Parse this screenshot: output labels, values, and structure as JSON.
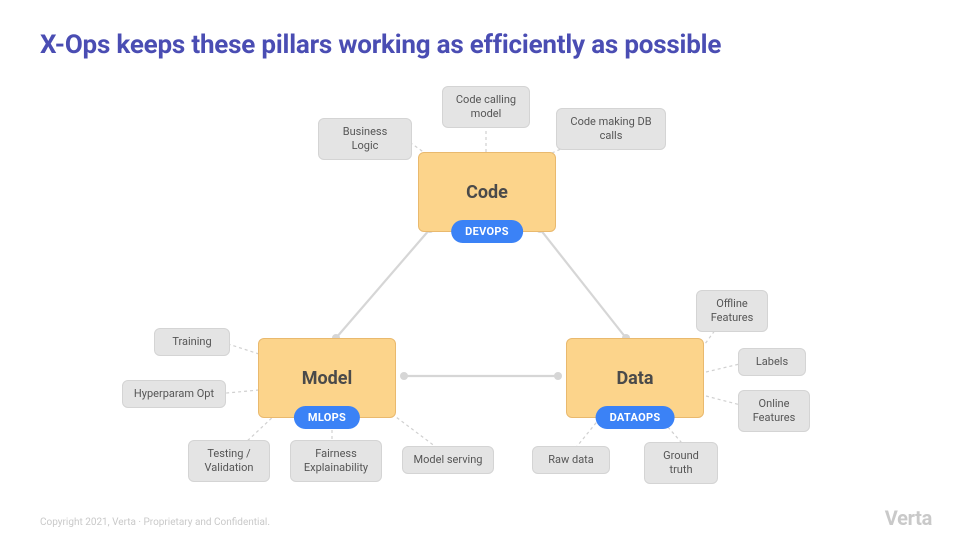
{
  "title": "X-Ops keeps these pillars working as efficiently as possible",
  "footer": "Copyright 2021, Verta  ·  Proprietary and Confidential.",
  "brand": "Verta",
  "pillars": {
    "code": {
      "label": "Code",
      "badge": "DEVOPS"
    },
    "model": {
      "label": "Model",
      "badge": "MLOPS"
    },
    "data": {
      "label": "Data",
      "badge": "DATAOPS"
    }
  },
  "tags": {
    "code": {
      "business_logic": "Business Logic",
      "code_calling_model": "Code calling model",
      "code_making_db_calls": "Code making DB calls"
    },
    "model": {
      "training": "Training",
      "hyperparam_opt": "Hyperparam Opt",
      "testing_validation": "Testing / Validation",
      "fairness_explainability": "Fairness Explainability",
      "model_serving": "Model serving"
    },
    "data": {
      "offline_features": "Offline Features",
      "labels": "Labels",
      "online_features": "Online Features",
      "raw_data": "Raw data",
      "ground_truth": "Ground truth"
    }
  }
}
